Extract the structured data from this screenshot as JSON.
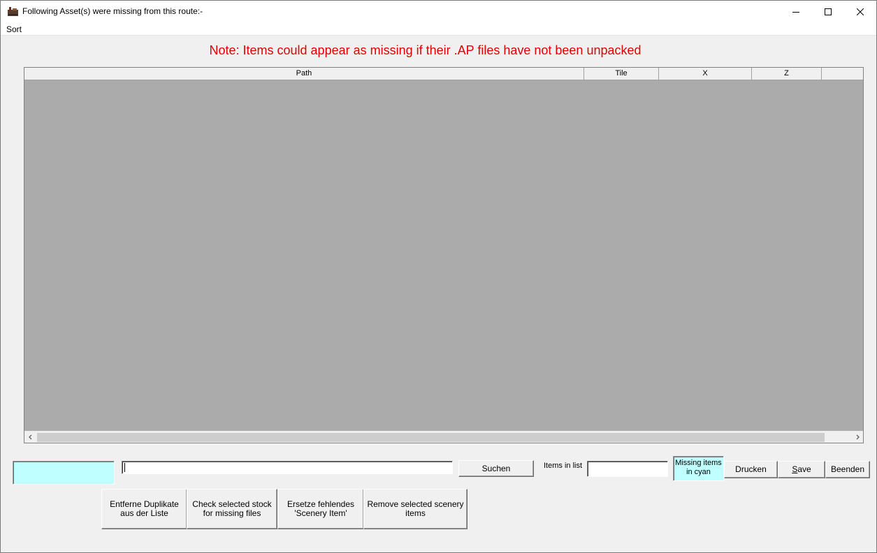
{
  "window": {
    "title": "Following Asset(s) were missing from this route:-",
    "icons": {
      "app": "route-app-icon",
      "minimize": "minimize-icon",
      "maximize": "maximize-icon",
      "close": "close-icon"
    }
  },
  "menu": {
    "items": [
      {
        "label": "Sort"
      }
    ]
  },
  "note": {
    "text": "Note: Items could appear as missing if their .AP files have not been unpacked",
    "color": "#e00000"
  },
  "list": {
    "columns": [
      {
        "label": "Path"
      },
      {
        "label": "Tile"
      },
      {
        "label": "X"
      },
      {
        "label": "Z"
      },
      {
        "label": ""
      }
    ],
    "rows": [],
    "background": "#ababab"
  },
  "search": {
    "value": "",
    "button_label": "Suchen"
  },
  "items_in_list": {
    "label": "Items in list",
    "value": ""
  },
  "legend": {
    "missing_label": "Missing items in cyan",
    "cyan_color": "#c0ffff"
  },
  "buttons": {
    "print": "Drucken",
    "save_prefix": "S",
    "save_rest": "ave",
    "exit": "Beenden",
    "remove_duplicates": "Entferne Duplikate aus der Liste",
    "check_stock": "Check selected stock for missing files",
    "replace_scenery": "Ersetze fehlendes 'Scenery Item'",
    "remove_scenery": "Remove selected scenery items"
  }
}
